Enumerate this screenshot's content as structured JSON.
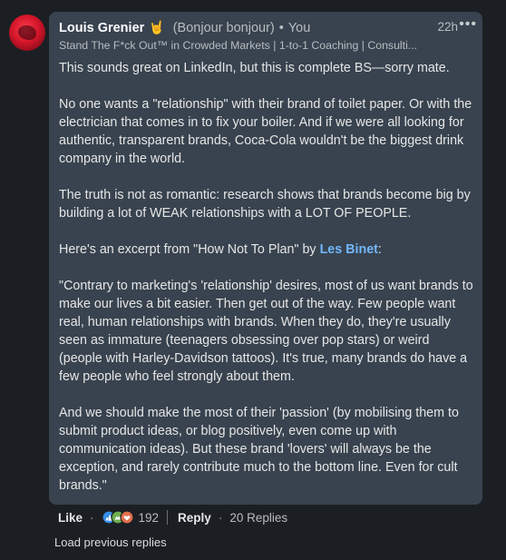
{
  "comment": {
    "author": "Louis Grenier",
    "emoji": "🤘",
    "pronoun": "(Bonjour bonjour)",
    "separator": "•",
    "degree": "You",
    "headline": "Stand The F*ck Out™ in Crowded Markets | 1-to-1 Coaching | Consulti...",
    "time": "22h",
    "more": "•••",
    "paragraphs": [
      "This sounds great on LinkedIn, but this is complete BS—sorry mate.",
      "No one wants a \"relationship\" with their brand of toilet paper. Or with the electrician that comes in to fix your boiler. And if we were all looking for authentic, transparent brands, Coca-Cola wouldn't be the biggest drink company in the world.",
      "The truth is not as romantic: research shows that brands become big by building a lot of WEAK relationships with a LOT OF PEOPLE."
    ],
    "excerpt_prefix": "Here's an excerpt from \"How Not To Plan\" by ",
    "excerpt_link": "Les Binet",
    "excerpt_suffix": ":",
    "quote_paragraphs": [
      "\"Contrary to marketing's 'relationship' desires, most of us want brands to make our lives a bit easier. Then get out of the way. Few people want real, human relationships with brands. When they do, they're usually seen as immature (teenagers obsessing over pop stars) or weird (people with Harley-Davidson tattoos). It's true, many brands do have a few people who feel strongly about them.",
      "And we should make the most of their 'passion' (by mobilising them to submit product ideas, or blog positively, even come up with communication ideas). But these brand 'lovers' will always be the exception, and rarely contribute much to the bottom line. Even for cult brands.\""
    ]
  },
  "actions": {
    "like": "Like",
    "dot": "·",
    "reaction_count": "192",
    "reply": "Reply",
    "replies": "20 Replies"
  },
  "load_previous": "Load previous replies",
  "colors": {
    "background": "#1b1f23",
    "bubble": "#38434f",
    "link": "#71b7fb"
  }
}
